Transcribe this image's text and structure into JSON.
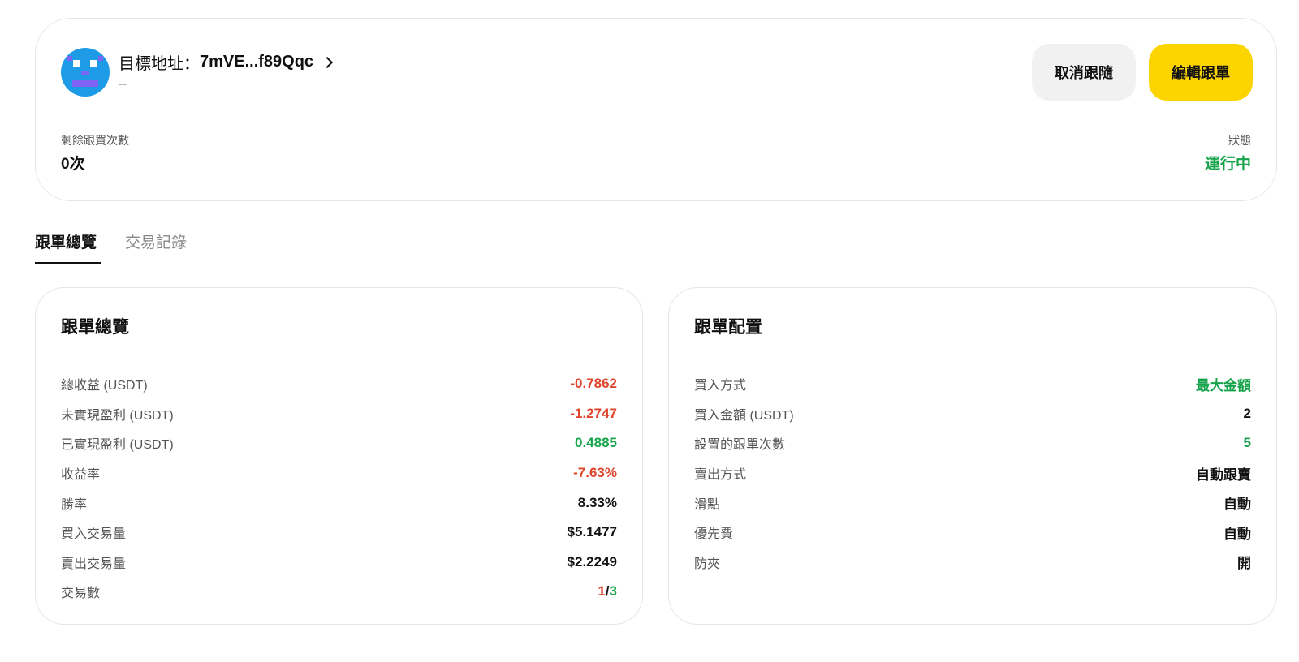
{
  "header": {
    "address_label": "目標地址：",
    "address_value": "7mVE...f89Qqc",
    "subtitle": "--",
    "cancel_button": "取消跟隨",
    "edit_button": "編輯跟單",
    "remaining_label": "剩餘跟買次數",
    "remaining_value": "0次",
    "status_label": "狀態",
    "status_value": "運行中",
    "status_color": "#16a34a"
  },
  "tabs": [
    {
      "label": "跟單總覽",
      "active": true
    },
    {
      "label": "交易記錄",
      "active": false
    }
  ],
  "overview": {
    "title": "跟單總覽",
    "rows": [
      {
        "label": "總收益 (USDT)",
        "value": "-0.7862",
        "tone": "neg"
      },
      {
        "label": "未實現盈利 (USDT)",
        "value": "-1.2747",
        "tone": "neg"
      },
      {
        "label": "已實現盈利 (USDT)",
        "value": "0.4885",
        "tone": "pos"
      },
      {
        "label": "收益率",
        "value": "-7.63%",
        "tone": "neg"
      },
      {
        "label": "勝率",
        "value": "8.33%",
        "tone": ""
      },
      {
        "label": "買入交易量",
        "value": "$5.1477",
        "tone": ""
      },
      {
        "label": "賣出交易量",
        "value": "$2.2249",
        "tone": ""
      }
    ],
    "trades": {
      "label": "交易數",
      "wins": "1",
      "sep": "/",
      "total": "3"
    }
  },
  "config": {
    "title": "跟單配置",
    "rows": [
      {
        "label": "買入方式",
        "value": "最大金額",
        "tone": "pos"
      },
      {
        "label": "買入金額 (USDT)",
        "value": "2",
        "tone": ""
      },
      {
        "label": "設置的跟單次數",
        "value": "5",
        "tone": "pos"
      },
      {
        "label": "賣出方式",
        "value": "自動跟賣",
        "tone": ""
      },
      {
        "label": "滑點",
        "value": "自動",
        "tone": ""
      },
      {
        "label": "優先費",
        "value": "自動",
        "tone": ""
      },
      {
        "label": "防夾",
        "value": "開",
        "tone": ""
      }
    ]
  },
  "colors": {
    "accent": "#fcd400",
    "negative": "#e0452b",
    "positive": "#16a34a",
    "avatar": "#1e9be6"
  }
}
